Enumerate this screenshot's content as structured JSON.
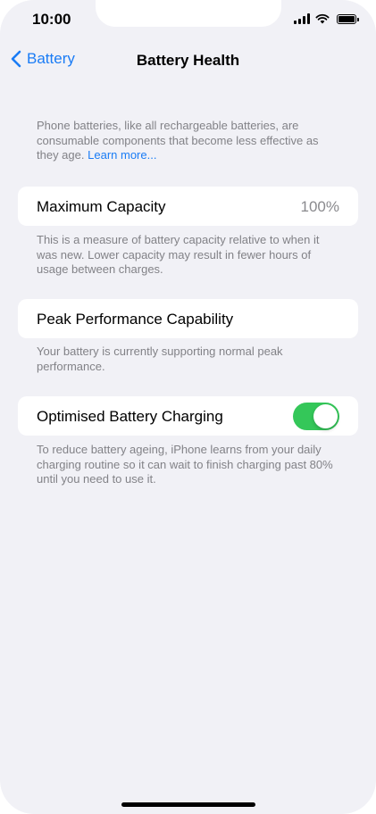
{
  "status_bar": {
    "time": "10:00"
  },
  "nav": {
    "back_label": "Battery",
    "title": "Battery Health"
  },
  "intro": {
    "text": "Phone batteries, like all rechargeable batteries, are consumable components that become less effective as they age.",
    "link": "Learn more..."
  },
  "max_capacity": {
    "label": "Maximum Capacity",
    "value": "100%",
    "footer": "This is a measure of battery capacity relative to when it was new. Lower capacity may result in fewer hours of usage between charges."
  },
  "peak_performance": {
    "label": "Peak Performance Capability",
    "footer": "Your battery is currently supporting normal peak performance."
  },
  "optimised_charging": {
    "label": "Optimised Battery Charging",
    "enabled": true,
    "footer": "To reduce battery ageing, iPhone learns from your daily charging routine so it can wait to finish charging past 80% until you need to use it."
  },
  "colors": {
    "accent": "#1a7cf5",
    "toggle_on": "#34c759",
    "background": "#f1f1f6"
  }
}
